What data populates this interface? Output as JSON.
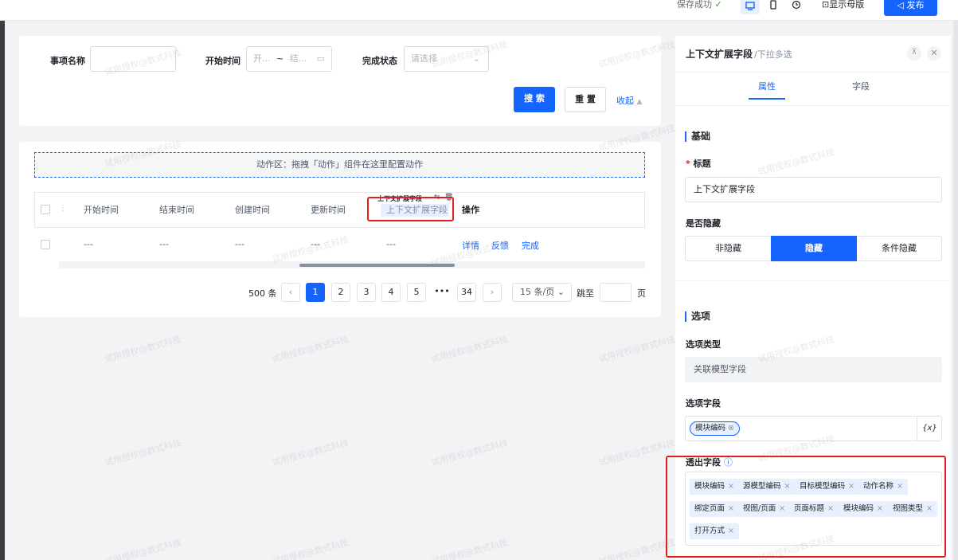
{
  "topbar": {
    "save_status": "保存成功",
    "publish": "发布",
    "show_master": "显示母版"
  },
  "search": {
    "name_label": "事项名称",
    "start_label": "开始时间",
    "start_placeholder": "开...",
    "range_sep": "~",
    "end_placeholder": "结...",
    "status_label": "完成状态",
    "status_placeholder": "请选择",
    "search_btn": "搜 索",
    "reset_btn": "重 置",
    "collapse": "收起"
  },
  "action_zone": "动作区：拖拽「动作」组件在这里配置动作",
  "table": {
    "columns": [
      "开始时间",
      "结束时间",
      "创建时间",
      "更新时间"
    ],
    "drag_col_title": "上下文扩展字段",
    "drag_col_label": "上下文扩展字段",
    "op_header": "操作",
    "row": [
      "---",
      "---",
      "---",
      "---",
      "---"
    ],
    "actions": [
      "详情",
      "反馈",
      "完成"
    ]
  },
  "pagination": {
    "total": "500 条",
    "pages": [
      "1",
      "2",
      "3",
      "4",
      "5",
      "•••",
      "34"
    ],
    "current": "1",
    "page_size": "15 条/页",
    "jump_label": "跳至",
    "page_unit": "页"
  },
  "panel": {
    "title": "上下文扩展字段",
    "subtitle": "/下拉多选",
    "tabs": [
      "属性",
      "字段"
    ],
    "active_tab": "属性",
    "basic_section": "基础",
    "title_label": "标题",
    "title_value": "上下文扩展字段",
    "hidden_label": "是否隐藏",
    "hidden_options": [
      "非隐藏",
      "隐藏",
      "条件隐藏"
    ],
    "hidden_selected": "隐藏",
    "options_section": "选项",
    "option_type_label": "选项类型",
    "option_type_value": "关联模型字段",
    "option_field_label": "选项字段",
    "option_field_tag": "模块编码",
    "variable_btn": "{x}",
    "output_label": "透出字段",
    "output_tags": [
      "模块编码",
      "源模型编码",
      "目标模型编码",
      "动作名称",
      "绑定页面",
      "视图/页面",
      "页面标题",
      "模块编码",
      "视图类型",
      "打开方式"
    ]
  },
  "watermark": "试用授权@数式科技",
  "colors": {
    "primary": "#1664ff",
    "highlight": "#e02020"
  }
}
